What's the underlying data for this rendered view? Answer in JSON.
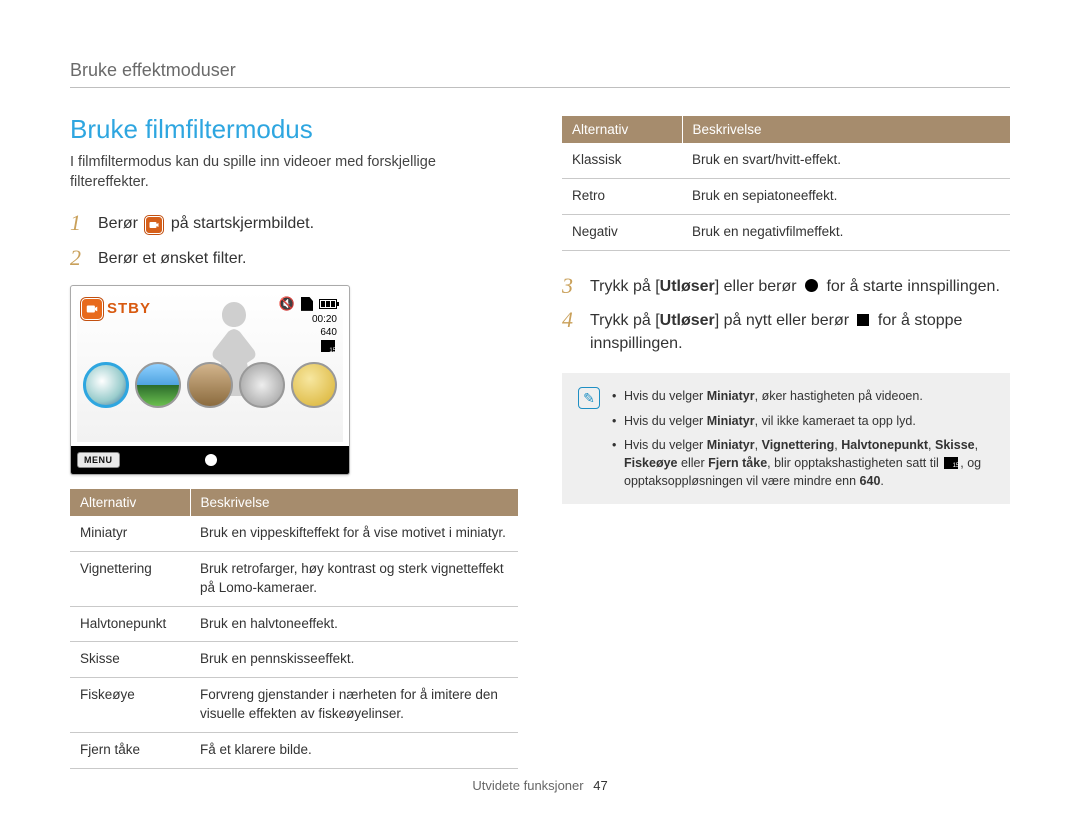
{
  "breadcrumb": "Bruke effektmoduser",
  "title": "Bruke filmfiltermodus",
  "intro": "I filmfiltermodus kan du spille inn videoer med forskjellige filtereffekter.",
  "steps_left": [
    {
      "num": "1",
      "before": "Berør ",
      "after": " på startskjermbildet."
    },
    {
      "num": "2",
      "text": "Berør et ønsket filter."
    }
  ],
  "screenshot": {
    "stby": "STBY",
    "menu": "MENU",
    "time": "00:20",
    "res": "640"
  },
  "left_table": {
    "headers": [
      "Alternativ",
      "Beskrivelse"
    ],
    "rows": [
      [
        "Miniatyr",
        "Bruk en vippeskifteffekt for å vise motivet i miniatyr."
      ],
      [
        "Vignettering",
        "Bruk retrofarger, høy kontrast og sterk vignetteffekt på Lomo-kameraer."
      ],
      [
        "Halvtonepunkt",
        "Bruk en halvtoneeffekt."
      ],
      [
        "Skisse",
        "Bruk en pennskisseeffekt."
      ],
      [
        "Fiskeøye",
        "Forvreng gjenstander i nærheten for å imitere den visuelle effekten av fiskeøyelinser."
      ],
      [
        "Fjern tåke",
        "Få et klarere bilde."
      ]
    ]
  },
  "right_table": {
    "headers": [
      "Alternativ",
      "Beskrivelse"
    ],
    "rows": [
      [
        "Klassisk",
        "Bruk en svart/hvitt-effekt."
      ],
      [
        "Retro",
        "Bruk en sepiatoneeffekt."
      ],
      [
        "Negativ",
        "Bruk en negativfilmeffekt."
      ]
    ]
  },
  "steps_right": [
    {
      "num": "3",
      "pre": "Trykk på [",
      "bold": "Utløser",
      "mid": "] eller berør ",
      "post": " for å starte innspillingen."
    },
    {
      "num": "4",
      "pre": "Trykk på [",
      "bold": "Utløser",
      "mid": "] på nytt eller berør ",
      "post": " for å stoppe innspillingen."
    }
  ],
  "note": {
    "items": [
      {
        "pre": "Hvis du velger ",
        "b1": "Miniatyr",
        "post": ", øker hastigheten på videoen."
      },
      {
        "pre": "Hvis du velger ",
        "b1": "Miniatyr",
        "post": ", vil ikke kameraet ta opp lyd."
      },
      {
        "pre": "Hvis du velger ",
        "b1": "Miniatyr",
        "b2": "Vignettering",
        "b3": "Halvtonepunkt",
        "b4": "Skisse",
        "b5": "Fiskeøye",
        "b6": "Fjern tåke",
        "mid": ", blir opptakshastigheten satt til ",
        "tail1": ", og opptaksoppløsningen vil være mindre enn ",
        "tail2": "640",
        "tail3": "."
      }
    ]
  },
  "footer": {
    "section": "Utvidete funksjoner",
    "page": "47"
  }
}
